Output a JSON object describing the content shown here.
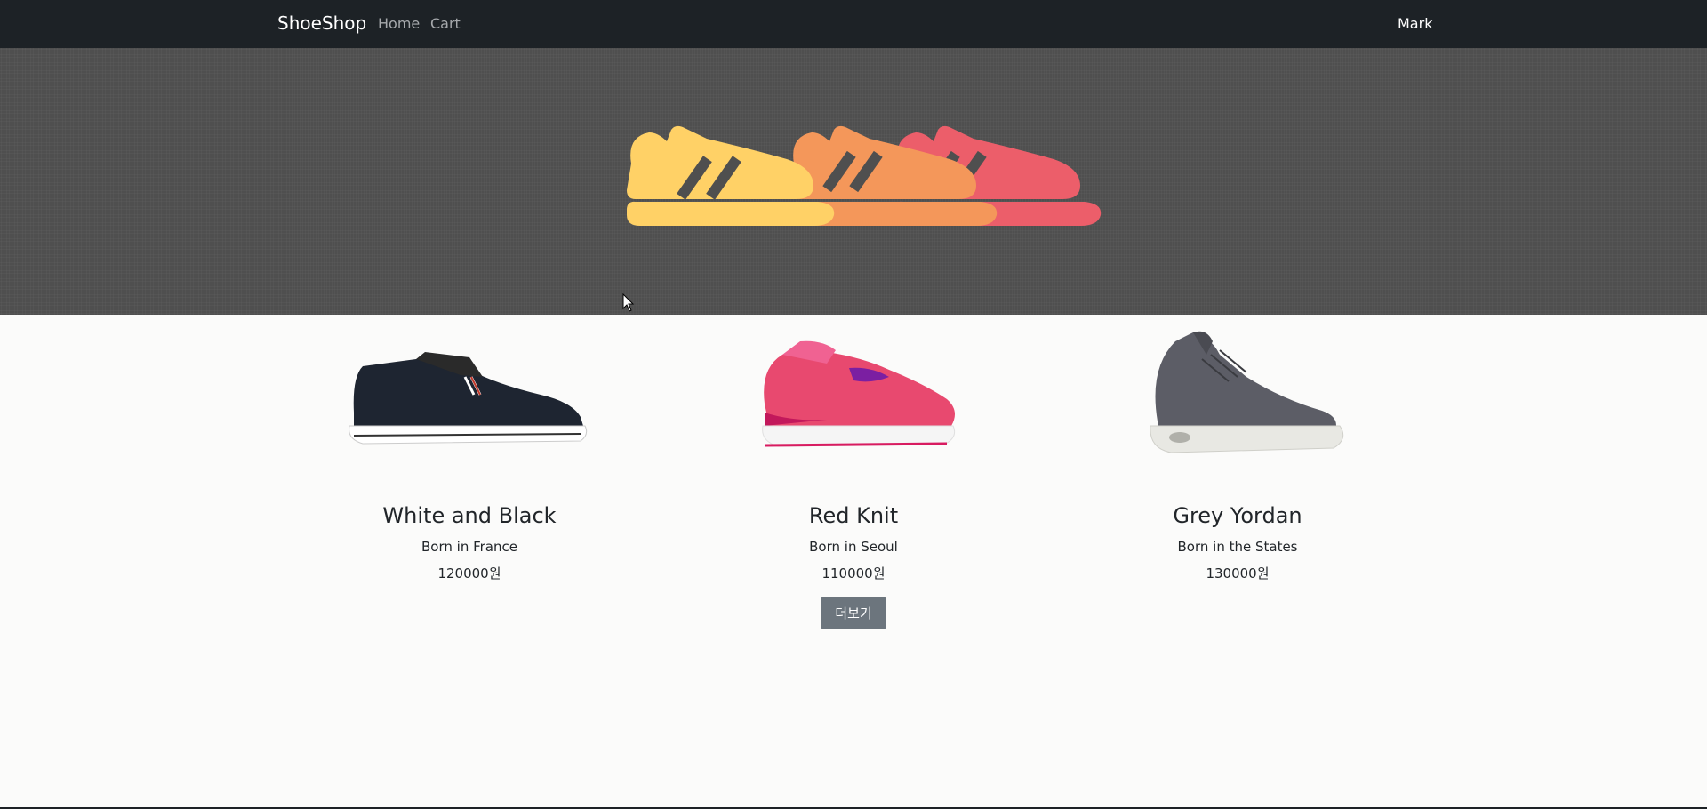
{
  "navbar": {
    "brand": "ShoeShop",
    "links": [
      "Home",
      "Cart"
    ],
    "user": "Mark"
  },
  "hero": {
    "image": "three-sneakers-icon",
    "colors": [
      "#ffd166",
      "#f4975a",
      "#ec5e6a"
    ]
  },
  "products": [
    {
      "title": "White and Black",
      "origin": "Born in France",
      "price": "120000원",
      "image": "black-canvas-sneaker"
    },
    {
      "title": "Red Knit",
      "origin": "Born in Seoul",
      "price": "110000원",
      "image": "pink-running-shoe"
    },
    {
      "title": "Grey Yordan",
      "origin": "Born in the States",
      "price": "130000원",
      "image": "grey-high-top-sneaker"
    }
  ],
  "more_button": "더보기"
}
